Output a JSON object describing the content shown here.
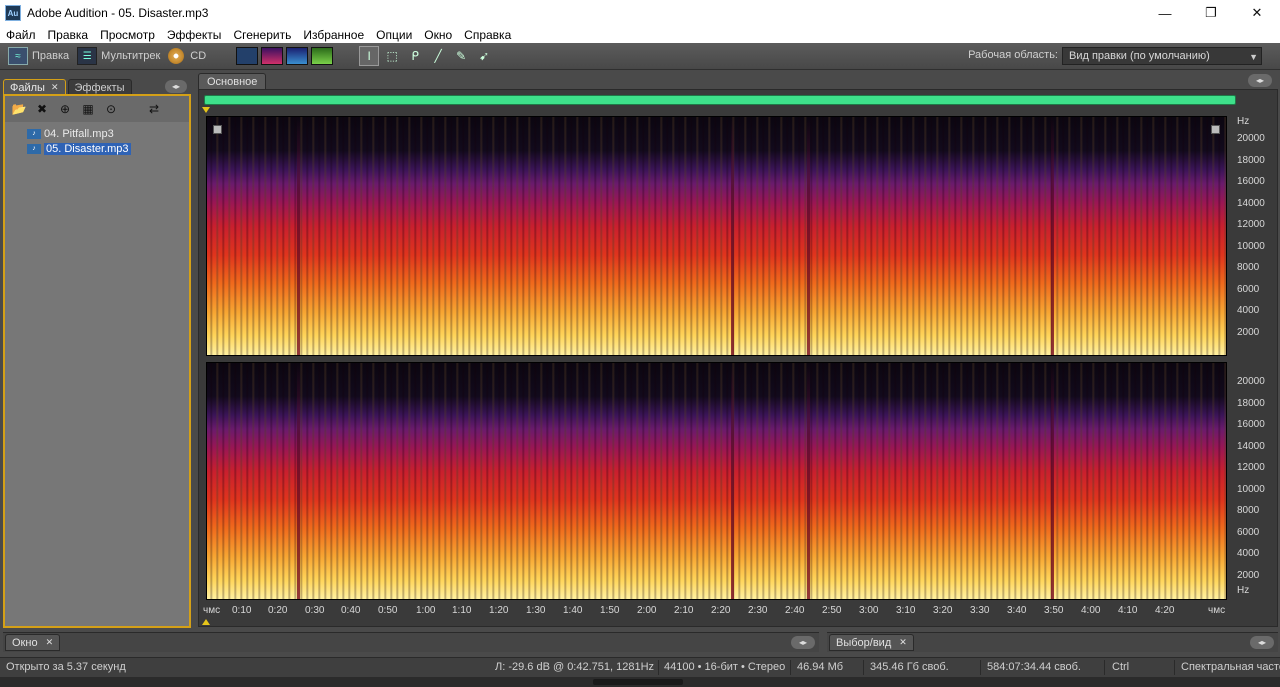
{
  "window": {
    "app_icon": "Au",
    "title": "Adobe Audition - 05. Disaster.mp3",
    "minimize": "—",
    "maximize": "❐",
    "close": "✕"
  },
  "menu": [
    "Файл",
    "Правка",
    "Просмотр",
    "Эффекты",
    "Сгенерить",
    "Избранное",
    "Опции",
    "Окно",
    "Справка"
  ],
  "toolbar": {
    "edit_label": "Правка",
    "multitrack_label": "Мультитрек",
    "cd_label": "CD",
    "workspace_label": "Рабочая область:",
    "workspace_value": "Вид правки (по умолчанию)"
  },
  "left_panel": {
    "tabs": [
      "Файлы",
      "Эффекты"
    ],
    "files": [
      {
        "name": "04. Pitfall.mp3",
        "selected": false
      },
      {
        "name": "05. Disaster.mp3",
        "selected": true
      }
    ]
  },
  "main": {
    "tab_label": "Основное",
    "hz_unit": "Hz",
    "hz_ticks": [
      "20000",
      "18000",
      "16000",
      "14000",
      "12000",
      "10000",
      "8000",
      "6000",
      "4000",
      "2000"
    ],
    "time_format": "чмс",
    "time_ticks": [
      "0:10",
      "0:20",
      "0:30",
      "0:40",
      "0:50",
      "1:00",
      "1:10",
      "1:20",
      "1:30",
      "1:40",
      "1:50",
      "2:00",
      "2:10",
      "2:20",
      "2:30",
      "2:40",
      "2:50",
      "3:00",
      "3:10",
      "3:20",
      "3:30",
      "3:40",
      "3:50",
      "4:00",
      "4:10",
      "4:20"
    ],
    "overview_color": "#3ee08a"
  },
  "bottom_panels": {
    "window_tab": "Окно",
    "selection_tab": "Выбор/вид"
  },
  "status": {
    "opened": "Открыто за 5.37 секунд",
    "level": "Л: -29.6 dB @  0:42.751, 1281Hz",
    "format": "44100 • 16-бит • Стерео",
    "size": "46.94 Мб",
    "free_space": "345.46 Гб своб.",
    "free_time": "584:07:34.44 своб.",
    "modifier": "Ctrl",
    "view_mode": "Спектральная часто"
  }
}
